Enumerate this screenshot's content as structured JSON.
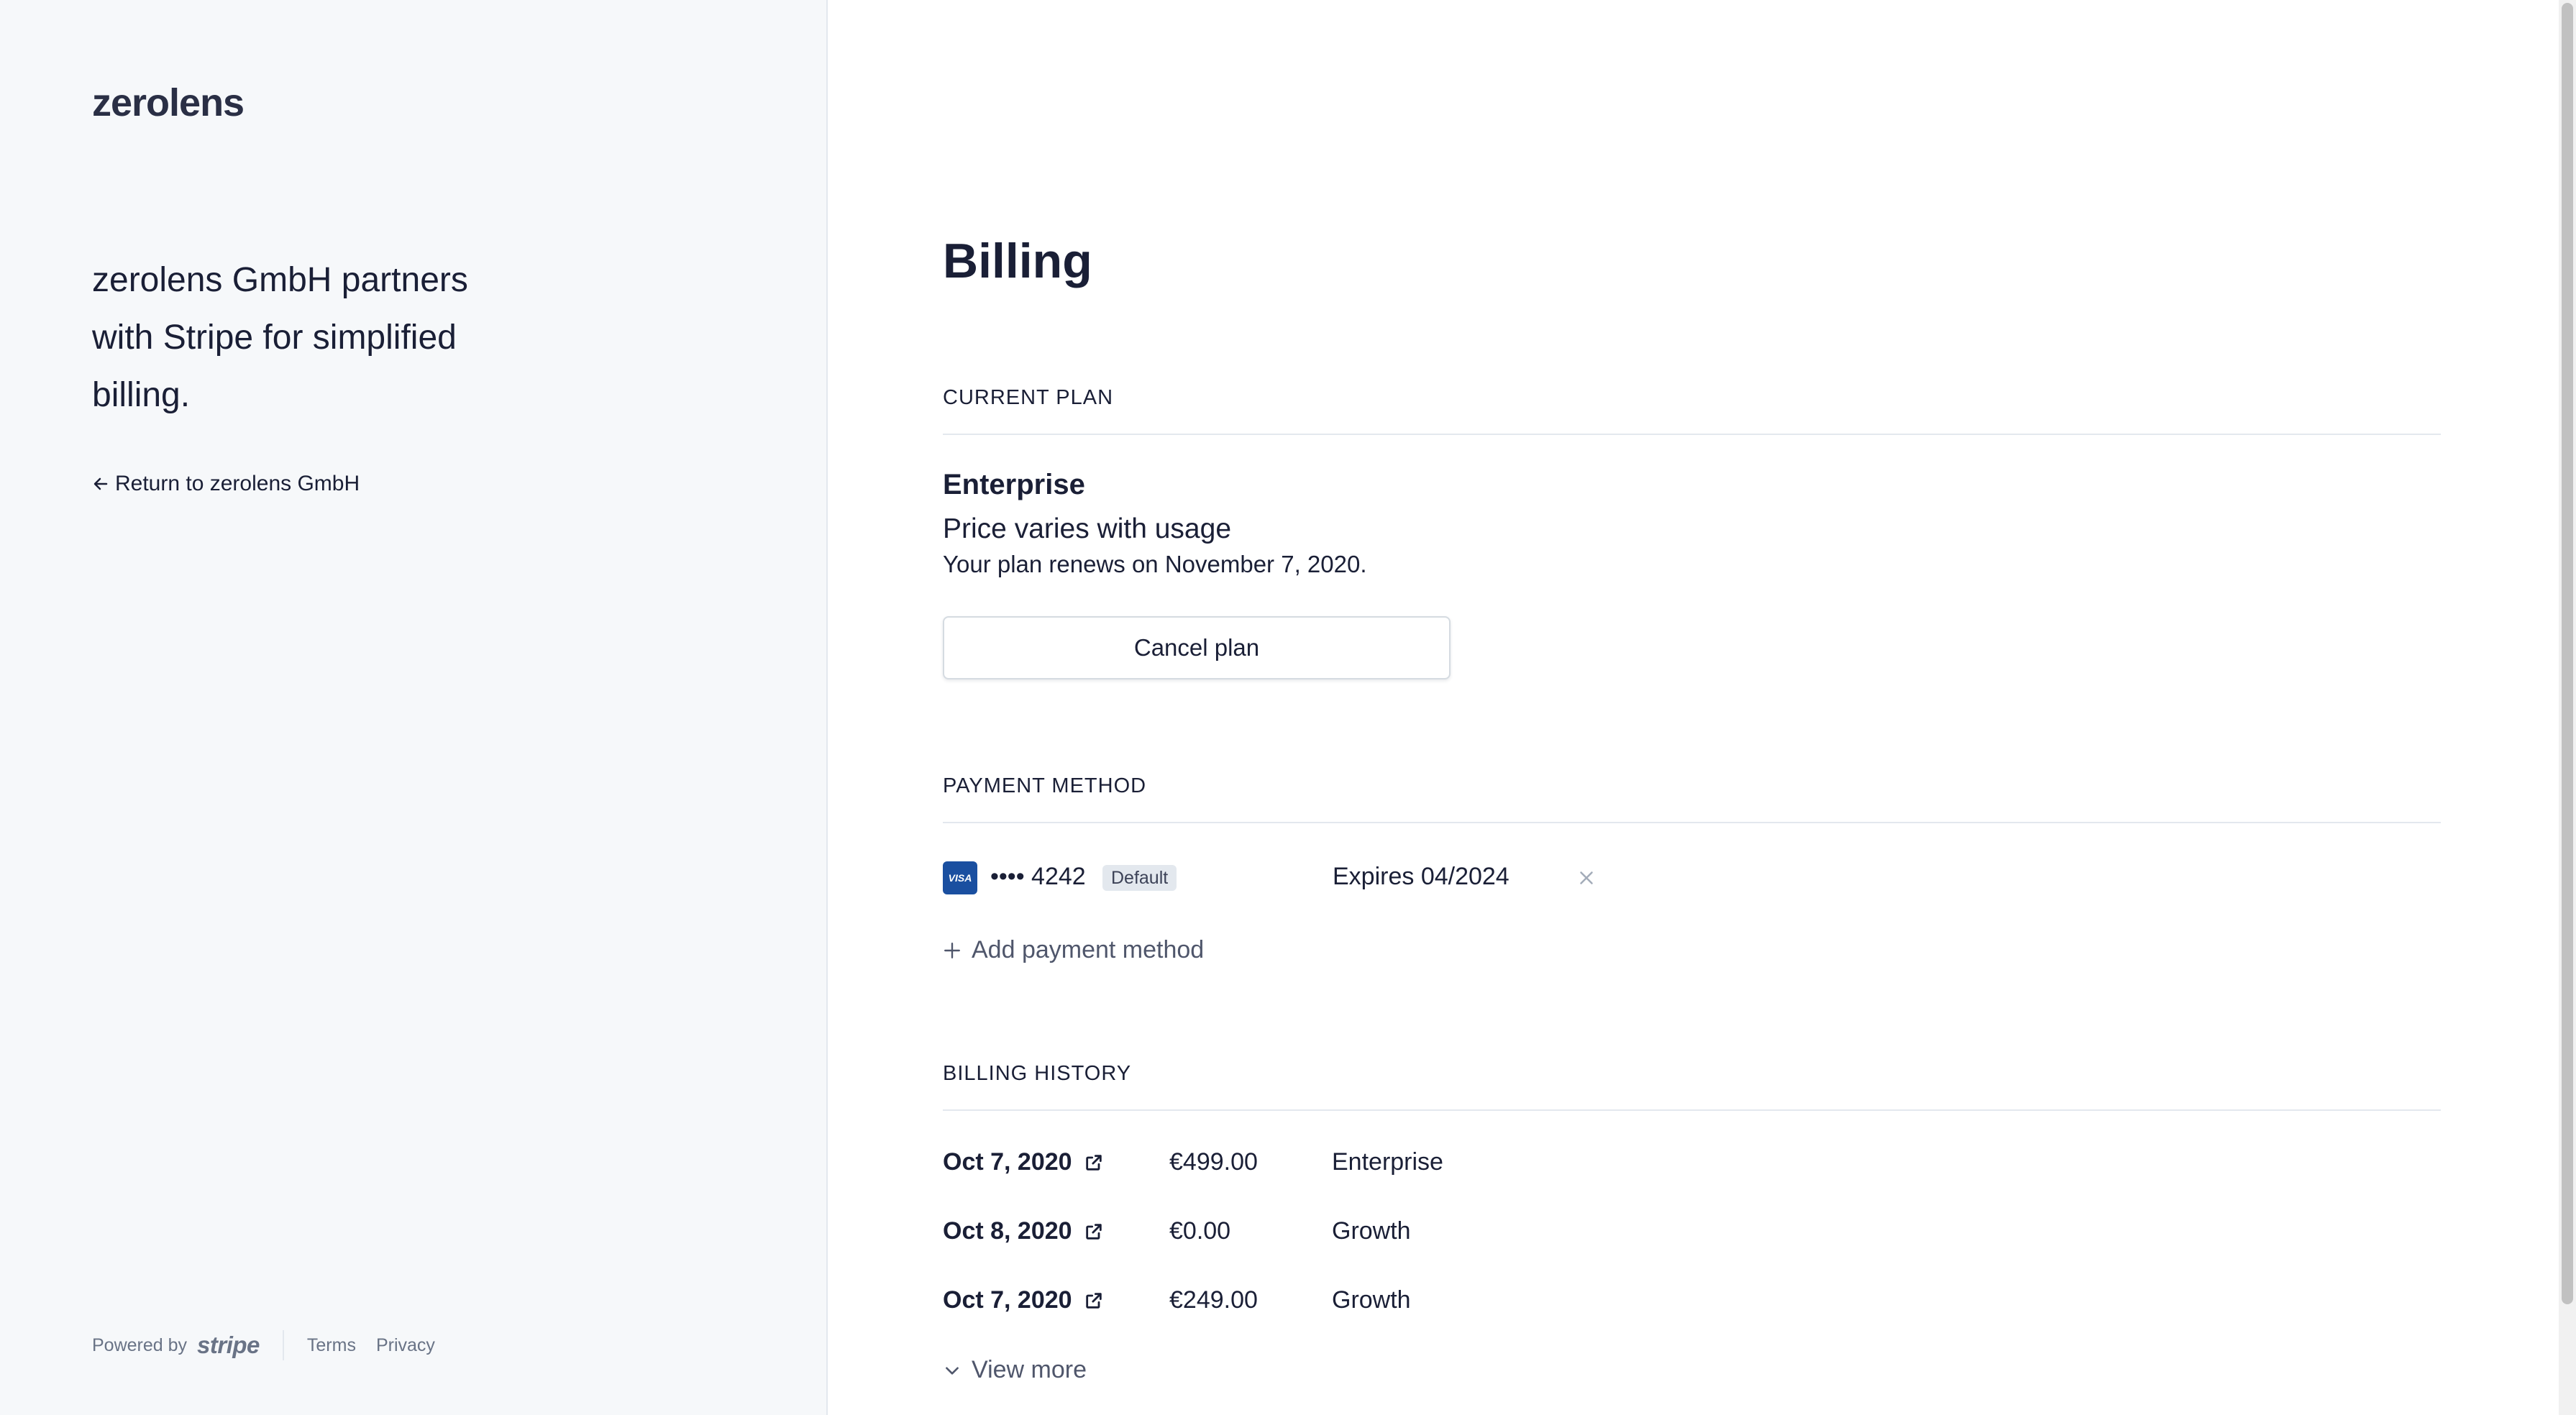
{
  "brand": {
    "logo_text": "zerolens",
    "tagline": "zerolens GmbH partners with Stripe for simplified billing.",
    "return_link": "Return to zerolens GmbH"
  },
  "footer": {
    "powered_by": "Powered by",
    "stripe_logo": "stripe",
    "terms": "Terms",
    "privacy": "Privacy"
  },
  "page": {
    "title": "Billing"
  },
  "current_plan": {
    "section_title": "CURRENT PLAN",
    "name": "Enterprise",
    "price": "Price varies with usage",
    "renewal": "Your plan renews on November 7, 2020.",
    "cancel_label": "Cancel plan"
  },
  "payment_method": {
    "section_title": "PAYMENT METHOD",
    "card_brand": "VISA",
    "card_number": "•••• 4242",
    "default_badge": "Default",
    "expires": "Expires 04/2024",
    "add_label": "Add payment method"
  },
  "billing_history": {
    "section_title": "BILLING HISTORY",
    "rows": [
      {
        "date": "Oct 7, 2020",
        "amount": "€499.00",
        "plan": "Enterprise"
      },
      {
        "date": "Oct 8, 2020",
        "amount": "€0.00",
        "plan": "Growth"
      },
      {
        "date": "Oct 7, 2020",
        "amount": "€249.00",
        "plan": "Growth"
      }
    ],
    "view_more_label": "View more"
  },
  "colors": {
    "left_panel_bg": "#f6f8fa",
    "text_primary": "#1a1f36",
    "text_secondary": "#4f566b",
    "visa_blue": "#1a4fa0"
  },
  "icons": [
    "arrow-left-icon",
    "visa-card-icon",
    "close-icon",
    "plus-icon",
    "external-link-icon",
    "chevron-down-icon"
  ]
}
